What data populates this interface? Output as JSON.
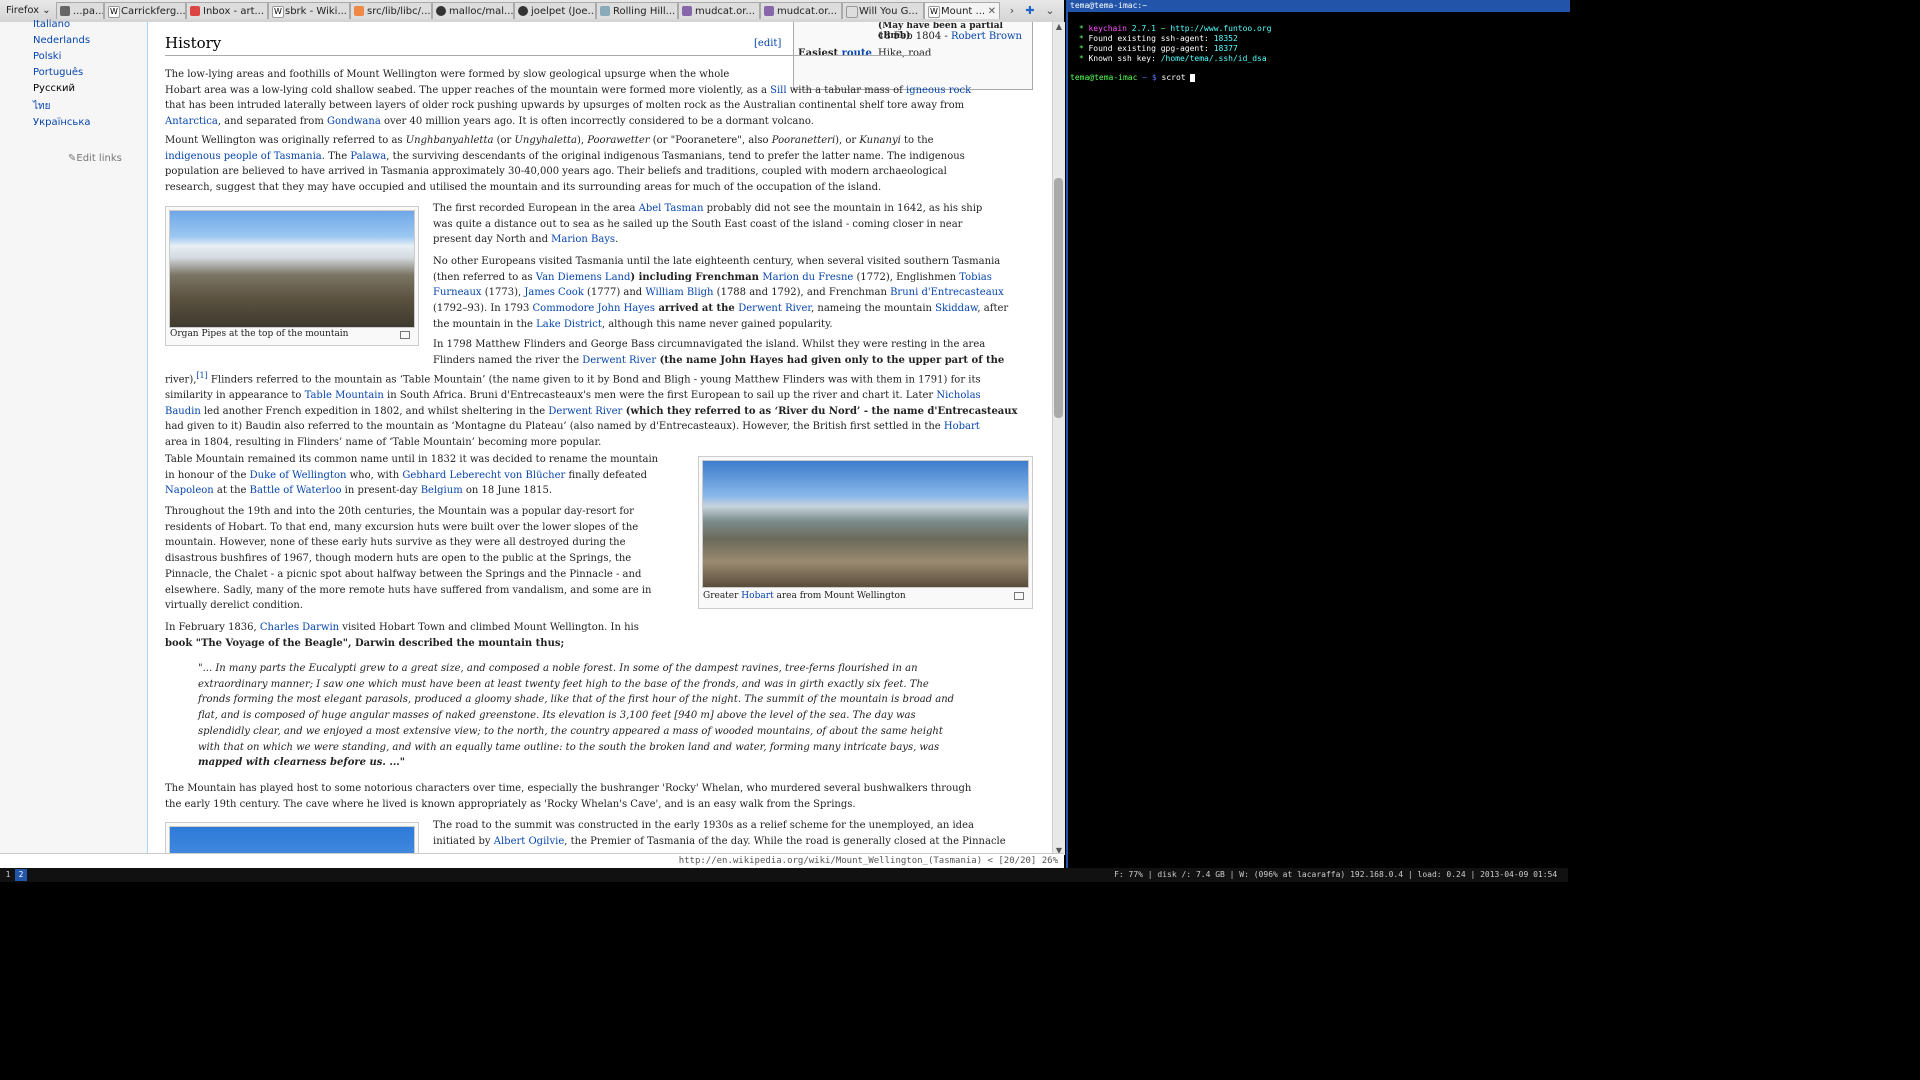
{
  "browser": {
    "menu_label": "Firefox",
    "tabs": [
      {
        "label": "...pa..."
      },
      {
        "label": "Carrickferg..."
      },
      {
        "label": "Inbox - art..."
      },
      {
        "label": "sbrk - Wiki..."
      },
      {
        "label": "src/lib/libc/..."
      },
      {
        "label": "malloc/mal..."
      },
      {
        "label": "joelpet (Joe..."
      },
      {
        "label": "Rolling Hill..."
      },
      {
        "label": "mudcat.or..."
      },
      {
        "label": "mudcat.or..."
      },
      {
        "label": "Will You G..."
      },
      {
        "label": "Mount ..."
      }
    ],
    "status_url": "http://en.wikipedia.org/wiki/Mount_Wellington_(Tasmania) < [20/20] 26%"
  },
  "sidebar": {
    "languages": [
      "Italiano",
      "Nederlands",
      "Polski",
      "Português",
      "Русский",
      "ไทย",
      "Українська"
    ],
    "edit_links": "Edit links"
  },
  "infobox": {
    "partial_note": "(May have been a partial climb)",
    "first_ascent_date": "18 Feb 1804 - ",
    "first_ascent_person": "Robert Brown",
    "easiest_label": "Easiest ",
    "route_label": "route",
    "route_value": "Hike, road"
  },
  "article": {
    "heading": "History",
    "edit": "[edit]",
    "p1": [
      "The low-lying areas and foothills of Mount Wellington were formed by slow geological upsurge when the whole",
      "Hobart area was a low-lying cold shallow seabed. The upper reaches of the mountain were formed more violently, as a ",
      "Sill",
      " with a tabular mass of ",
      "igneous rock",
      "that has been intruded laterally between layers of older rock pushing upwards by upsurges of molten rock as the Australian continental shelf tore away from",
      "Antarctica",
      ", and separated from ",
      "Gondwana",
      " over 40 million years ago. It is often incorrectly considered to be a dormant volcano."
    ],
    "p2": [
      "Mount Wellington was originally referred to as ",
      "Unghbanyahletta",
      " (or ",
      "Ungyhaletta",
      "), ",
      "Poorawetter",
      " (or \"Pooranetere\", also ",
      "Pooranetteri",
      "), or ",
      "Kunanyi",
      " to the",
      "indigenous people of Tasmania",
      ". The ",
      "Palawa",
      ", the surviving descendants of the original indigenous Tasmanians, tend to prefer the latter name. The indigenous",
      "population are believed to have arrived in Tasmania approximately 30-40,000 years ago. Their beliefs and traditions, coupled with modern archaeological",
      "research, suggest that they may have occupied and utilised the mountain and its surrounding areas for much of the occupation of the island."
    ],
    "thumb1_caption": "Organ Pipes at the top of the mountain",
    "p3": [
      "The first recorded European in the area ",
      "Abel Tasman",
      " probably did not see the mountain in 1642, as his ship",
      "was quite a distance out to sea as he sailed up the South East coast of the island - coming closer in near",
      "present day North and ",
      "Marion Bays",
      "."
    ],
    "p4": [
      "No other Europeans visited Tasmania until the late eighteenth century, when several visited southern Tasmania",
      "(then referred to as ",
      "Van Diemens Land",
      ") including Frenchman ",
      "Marion du Fresne",
      " (1772), Englishmen ",
      "Tobias",
      "Furneaux",
      " (1773), ",
      "James Cook",
      " (1777) and ",
      "William Bligh",
      " (1788 and 1792), and Frenchman ",
      "Bruni d'Entrecasteaux",
      "(1792–93). In 1793 ",
      "Commodore John Hayes",
      " arrived at the ",
      "Derwent River",
      ", nameing the mountain ",
      "Skiddaw",
      ", after",
      "the mountain in the ",
      "Lake District",
      ", although this name never gained popularity."
    ],
    "p5": [
      "In 1798 Matthew Flinders and George Bass circumnavigated the island. Whilst they were resting in the area",
      "Flinders named the river the ",
      "Derwent River",
      " (the name John Hayes had given only to the upper part of the",
      "river),",
      "[1]",
      " Flinders referred to the mountain as ‘Table Mountain’ (the name given to it by Bond and Bligh - young Matthew Flinders was with them in 1791) for its",
      "similarity in appearance to ",
      "Table Mountain",
      " in South Africa. Bruni d'Entrecasteaux's men were the first European to sail up the river and chart it. Later ",
      "Nicholas",
      "Baudin",
      " led another French expedition in 1802, and whilst sheltering in the ",
      "Derwent River",
      " (which they referred to as ‘River du Nord’ - the name d'Entrecasteaux",
      "had given to it) Baudin also referred to the mountain as ‘Montagne du Plateau’ (also named by d'Entrecasteaux). However, the British first settled in the ",
      "Hobart",
      "area in 1804, resulting in Flinders’ name of ‘Table Mountain’ becoming more popular."
    ],
    "p6": [
      "Table Mountain remained its common name until in 1832 it was decided to rename the mountain",
      "in honour of the ",
      "Duke of Wellington",
      " who, with ",
      "Gebhard Leberecht von Blücher",
      " finally defeated",
      "Napoleon",
      " at the ",
      "Battle of Waterloo",
      " in present-day ",
      "Belgium",
      " on 18 June 1815."
    ],
    "thumb2_caption_pre": "Greater ",
    "thumb2_caption_link": "Hobart",
    "thumb2_caption_post": " area from Mount Wellington",
    "p7": [
      "Throughout the 19th and into the 20th centuries, the Mountain was a popular day-resort for",
      "residents of Hobart. To that end, many excursion huts were built over the lower slopes of the",
      "mountain. However, none of these early huts survive as they were all destroyed during the",
      "disastrous bushfires of 1967, though modern huts are open to the public at the Springs, the",
      "Pinnacle, the Chalet - a picnic spot about halfway between the Springs and the Pinnacle - and",
      "elsewhere. Sadly, many of the more remote huts have suffered from vandalism, and some are in",
      "virtually derelict condition."
    ],
    "p8": [
      "In February 1836, ",
      "Charles Darwin",
      " visited Hobart Town and climbed Mount Wellington. In his",
      "book \"The Voyage of the Beagle\", Darwin described the mountain thus;"
    ],
    "quote": [
      "\"... In many parts the Eucalypti grew to a great size, and composed a noble forest. In some of the dampest ravines, tree-ferns flourished in an",
      "extraordinary manner; I saw one which must have been at least twenty feet high to the base of the fronds, and was in girth exactly six feet. The",
      "fronds forming the most elegant parasols, produced a gloomy shade, like that of the first hour of the night. The summit of the mountain is broad and",
      "flat, and is composed of huge angular masses of naked greenstone. Its elevation is 3,100 feet [940 m] above the level of the sea. The day was",
      "splendidly clear, and we enjoyed a most extensive view; to the north, the country appeared a mass of wooded mountains, of about the same height",
      "with that on which we were standing, and with an equally tame outline: to the south the broken land and water, forming many intricate bays, was",
      "mapped with clearness before us. ...\""
    ],
    "p9": [
      "The Mountain has played host to some notorious characters over time, especially the bushranger 'Rocky' Whelan, who murdered several bushwalkers through",
      "the early 19th century. The cave where he lived is known appropriately as 'Rocky Whelan's Cave', and is an easy walk from the Springs."
    ],
    "p10": [
      "The road to the summit was constructed in the early 1930s as a relief scheme for the unemployed, an idea",
      "initiated by ",
      "Albert Ogilvie",
      ", the Premier of Tasmania of the day. While the road is generally closed at the Pinnacle"
    ]
  },
  "terminal": {
    "title": "tema@tema-imac:~",
    "lines": [
      {
        "bullet": " * ",
        "k1": "keychain",
        "k2": " 2.7.1",
        "k3": " ~ ",
        "k4": "http://www.funtoo.org"
      },
      {
        "bullet": " * ",
        "text": "Found existing ssh-agent: ",
        "val": "18352"
      },
      {
        "bullet": " * ",
        "text": "Found existing gpg-agent: ",
        "val": "18377"
      },
      {
        "bullet": " * ",
        "text": "Known ssh key: ",
        "val": "/home/tema/.ssh/id_dsa"
      }
    ],
    "prompt_user": "tema@tema-imac",
    "prompt_rest": " ~ $ ",
    "command": "scrot "
  },
  "wm": {
    "workspaces": [
      "1",
      "2"
    ],
    "status": "F: 77% | disk /: 7.4 GB | W: (096% at lacaraffa) 192.168.0.4 | load: 0.24 | 2013-04-09 01:54 "
  },
  "colors": {
    "link": "#0645ad",
    "terminal_accent": "#2255aa",
    "terminal_green": "#55ff55",
    "terminal_cyan": "#55ffff"
  }
}
